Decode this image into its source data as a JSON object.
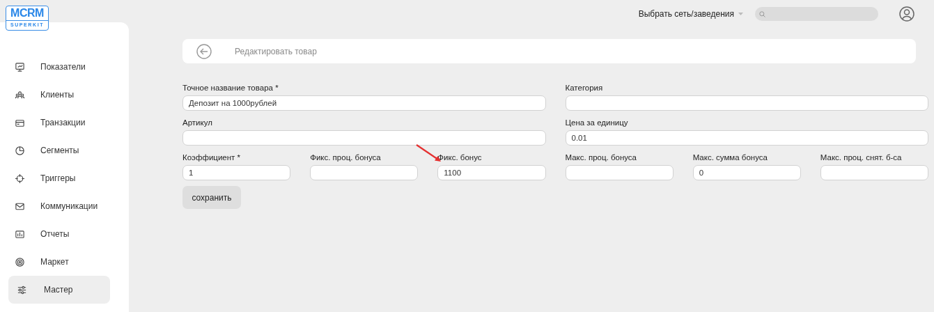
{
  "logo": {
    "title": "MCRM",
    "subtitle": "SUPERKIT"
  },
  "topbar": {
    "venue_select": "Выбрать сеть/заведения"
  },
  "sidebar": {
    "items": [
      {
        "label": "Показатели",
        "selected": false
      },
      {
        "label": "Клиенты",
        "selected": false
      },
      {
        "label": "Транзакции",
        "selected": false
      },
      {
        "label": "Сегменты",
        "selected": false
      },
      {
        "label": "Триггеры",
        "selected": false
      },
      {
        "label": "Коммуникации",
        "selected": false
      },
      {
        "label": "Отчеты",
        "selected": false
      },
      {
        "label": "Маркет",
        "selected": false
      },
      {
        "label": "Мастер",
        "selected": true
      }
    ]
  },
  "page_title": "Редактировать товар",
  "form": {
    "fields": [
      {
        "label": "Точное название товара *",
        "value": "Депозит на 1000рублей",
        "kind": "wide"
      },
      {
        "label": "Категория",
        "kind": "wide"
      },
      {
        "label": "Артикул",
        "kind": "wide"
      },
      {
        "label": "Цена за единицу",
        "value": "0.01",
        "kind": "wide"
      },
      {
        "label": "Коэффициент *",
        "value": "1",
        "kind": "narrow"
      },
      {
        "label": "Фикс. проц. бонуса",
        "kind": "narrow"
      },
      {
        "label": "Фикс. бонус",
        "value": "1100",
        "kind": "narrow"
      },
      {
        "label": "Макс. проц. бонуса",
        "kind": "narrow"
      },
      {
        "label": "Макс. сумма бонуса",
        "value": "0",
        "kind": "narrow"
      },
      {
        "label": "Макс. проц. снят. б-са",
        "kind": "narrow"
      }
    ],
    "save_button": "сохранить"
  }
}
